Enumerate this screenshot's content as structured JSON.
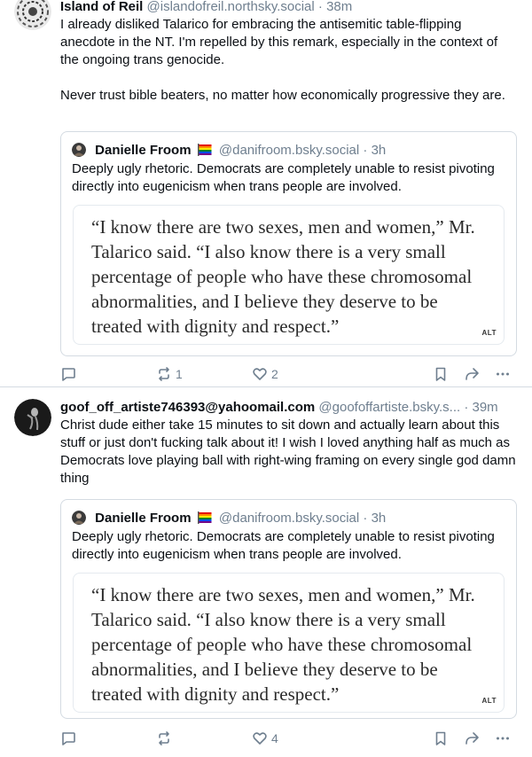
{
  "posts": [
    {
      "author": {
        "display_name": "Island of Reil",
        "handle": "@islandofreil.northsky.social",
        "time": "38m"
      },
      "separator": "·",
      "text": "I already disliked Talarico for embracing the antisemitic table-flipping anecdote in the NT. I'm repelled by this remark, especially in the context of the ongoing trans genocide.\n\nNever trust bible beaters, no matter how economically progressive they are.",
      "quote": {
        "author": {
          "display_name": "Danielle Froom",
          "handle": "@danifroom.bsky.social",
          "time": "3h"
        },
        "text": "Deeply ugly rhetoric. Democrats are completely unable to resist pivoting directly into eugenicism when trans people are involved.",
        "image_text": "“I know there are two sexes, men and women,” Mr. Talarico said. “I also know there is a very small percentage of people who have these chromosomal abnormalities, and I believe they deserve to be treated with dignity and respect.”",
        "alt_badge": "ALT"
      },
      "actions": {
        "reply_count": "",
        "repost_count": "1",
        "like_count": "2"
      }
    },
    {
      "author": {
        "display_name": "goof_off_artiste746393@yahoomail.com",
        "handle": "@goofoffartiste.bsky.s...",
        "time": "39m"
      },
      "separator": "·",
      "text": "Christ dude either take 15 minutes to sit down and actually learn about this stuff or just don't fucking talk about it! I wish I loved anything half as much as Democrats love playing ball with right-wing framing on every single god damn thing",
      "quote": {
        "author": {
          "display_name": "Danielle Froom",
          "handle": "@danifroom.bsky.social",
          "time": "3h"
        },
        "text": "Deeply ugly rhetoric. Democrats are completely unable to resist pivoting directly into eugenicism when trans people are involved.",
        "image_text": "“I know there are two sexes, men and women,” Mr. Talarico said. “I also know there is a very small percentage of people who have these chromosomal abnormalities, and I believe they deserve to be treated with dignity and respect.”",
        "alt_badge": "ALT"
      },
      "actions": {
        "reply_count": "",
        "repost_count": "",
        "like_count": "4"
      }
    }
  ],
  "icons": {
    "reply": "speech-bubble-icon",
    "repost": "repost-arrows-icon",
    "like": "heart-icon",
    "bookmark": "bookmark-icon",
    "share": "share-arrow-icon",
    "more": "ellipsis-icon"
  },
  "colors": {
    "text": "#0b0f14",
    "muted": "#6f7f8f",
    "border": "#d4dbe2"
  }
}
